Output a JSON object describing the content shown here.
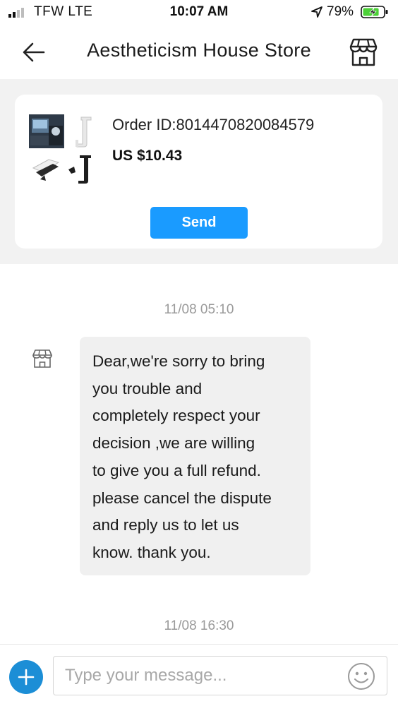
{
  "status_bar": {
    "carrier": "TFW  LTE",
    "time": "10:07 AM",
    "battery_percent": "79%",
    "battery_level": 0.79,
    "battery_charging": true
  },
  "header": {
    "title": "Aestheticism House Store",
    "back_icon": "arrow-left-icon",
    "store_icon": "storefront-icon"
  },
  "order_card": {
    "order_id": "Order ID:8014470820084579",
    "price": "US $10.43",
    "send_label": "Send",
    "thumbnail": "product-thumbnail"
  },
  "chat": {
    "messages": [
      {
        "timestamp": "11/08 05:10",
        "sender_icon": "storefront-icon",
        "text": "Dear,we're sorry to bring\nyou trouble and\ncompletely respect your\ndecision ,we are willing\nto give you a full refund.\nplease cancel the dispute\nand reply us to let us\nknow. thank you."
      },
      {
        "timestamp": "11/08 16:30"
      }
    ]
  },
  "composer": {
    "placeholder": "Type your message...",
    "value": "",
    "add_icon": "plus-icon",
    "emoji_icon": "smiley-icon"
  },
  "colors": {
    "accent": "#1a9bff",
    "add_button": "#1c8ed6",
    "order_section_bg": "#f2f2f2",
    "bubble_bg": "#f0f0f0",
    "timestamp_text": "#9a9a9a",
    "battery_green": "#4cd137"
  }
}
